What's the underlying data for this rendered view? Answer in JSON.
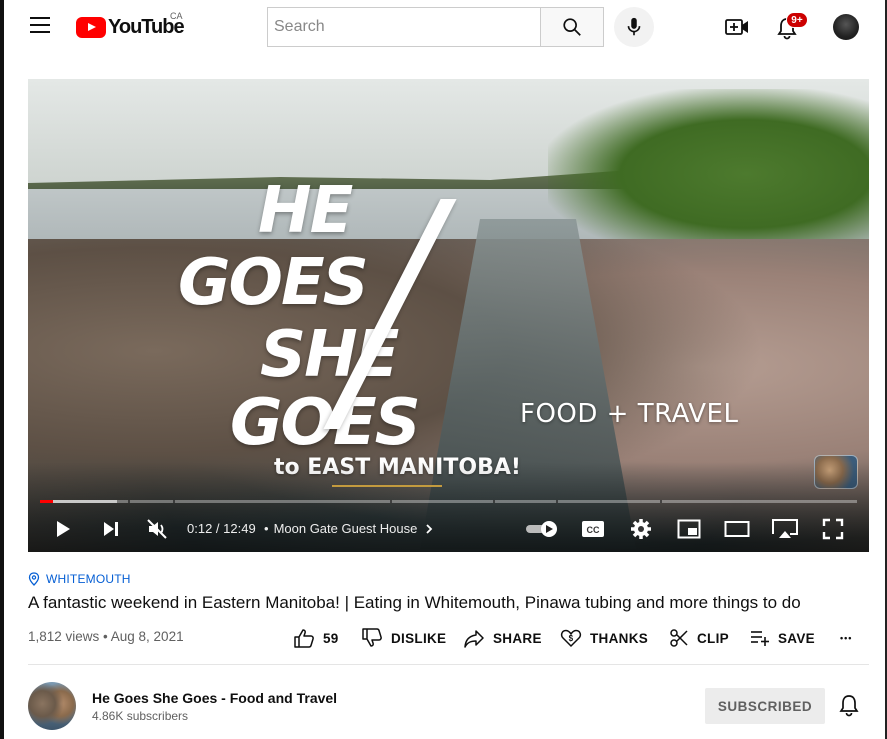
{
  "header": {
    "logo_text": "YouTube",
    "country_code": "CA",
    "search_placeholder": "Search",
    "notification_count": "9+"
  },
  "player": {
    "overlay": {
      "line1": "HE",
      "line2": "GOES",
      "line3": "SHE",
      "line4": "GOES",
      "tagline": "FOOD + TRAVEL",
      "destination": "to EAST MANITOBA!"
    },
    "current_time": "0:12",
    "duration": "12:49",
    "time_display": "0:12 / 12:49",
    "chapter_separator": "•",
    "chapter_title": "Moon Gate Guest House",
    "played_fraction": 0.016,
    "buffered_fraction": 0.094,
    "muted": true,
    "autoplay_on": true
  },
  "video": {
    "location": "WHITEMOUTH",
    "title": "A fantastic weekend in Eastern Manitoba! | Eating in Whitemouth, Pinawa tubing and more things to do",
    "views_date": "1,812 views • Aug 8, 2021",
    "actions": {
      "like_count": "59",
      "dislike_label": "DISLIKE",
      "share_label": "SHARE",
      "thanks_label": "THANKS",
      "clip_label": "CLIP",
      "save_label": "SAVE",
      "more_label": "•••"
    }
  },
  "channel": {
    "name": "He Goes She Goes - Food and Travel",
    "subscribers": "4.86K subscribers",
    "subscribe_state": "SUBSCRIBED"
  },
  "colors": {
    "brand_red": "#ff0000",
    "link_blue": "#065fd4",
    "secondary_text": "#606060"
  },
  "icons": [
    "menu-icon",
    "youtube-logo-icon",
    "search-icon",
    "microphone-icon",
    "create-video-icon",
    "bell-icon",
    "user-avatar",
    "play-icon",
    "next-icon",
    "mute-icon",
    "chevron-right-icon",
    "autoplay-toggle-icon",
    "captions-icon",
    "settings-gear-icon",
    "miniplayer-icon",
    "theater-mode-icon",
    "cast-icon",
    "fullscreen-icon",
    "location-pin-icon",
    "thumbs-up-icon",
    "thumbs-down-icon",
    "share-arrow-icon",
    "thanks-heart-icon",
    "clip-scissors-icon",
    "save-playlist-icon",
    "more-dots-icon",
    "bell-subscription-icon"
  ]
}
